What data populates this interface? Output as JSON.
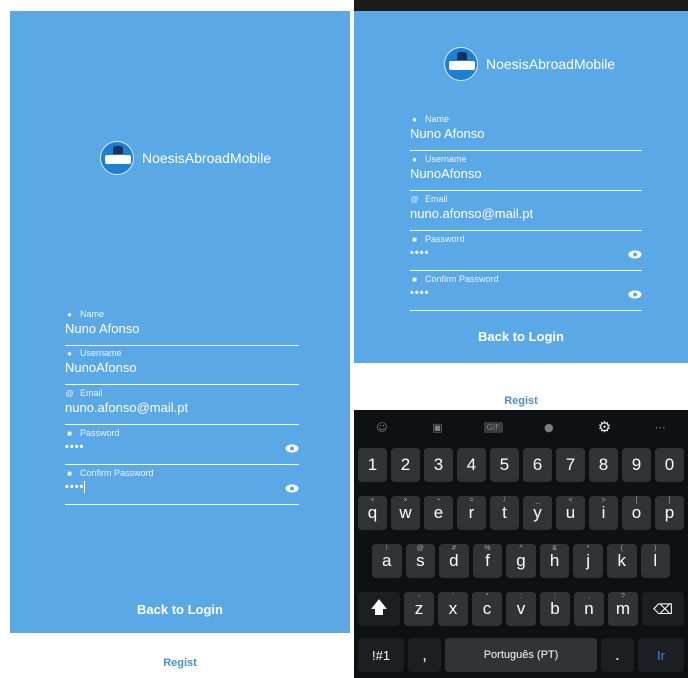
{
  "app": {
    "name": "NoesisAbroadMobile"
  },
  "form": {
    "fields": [
      {
        "label": "Name",
        "icon": "person-icon",
        "value": "Nuno Afonso"
      },
      {
        "label": "Username",
        "icon": "person-icon",
        "value": "NunoAfonso"
      },
      {
        "label": "Email",
        "icon": "at-icon",
        "value": "nuno.afonso@mail.pt"
      },
      {
        "label": "Password",
        "icon": "lock-icon",
        "value": "••••"
      },
      {
        "label": "Confirm Password",
        "icon": "lock-icon",
        "value": "••••"
      }
    ],
    "back_to_login": "Back to Login",
    "regist": "Regist"
  },
  "keyboard": {
    "toolbar": [
      "emoji-icon",
      "sticker-icon",
      "gif-icon",
      "microphone-icon",
      "settings-icon",
      "more-icon"
    ],
    "gif_label": "GIF",
    "numbers": [
      "1",
      "2",
      "3",
      "4",
      "5",
      "6",
      "7",
      "8",
      "9",
      "0"
    ],
    "row1": [
      [
        "q",
        "+"
      ],
      [
        "w",
        "×"
      ],
      [
        "e",
        "÷"
      ],
      [
        "r",
        "="
      ],
      [
        "t",
        "/"
      ],
      [
        "y",
        "_"
      ],
      [
        "u",
        "<"
      ],
      [
        "i",
        ">"
      ],
      [
        "o",
        "["
      ],
      [
        "p",
        "]"
      ]
    ],
    "row2": [
      [
        "a",
        "!"
      ],
      [
        "s",
        "@"
      ],
      [
        "d",
        "#"
      ],
      [
        "f",
        "%"
      ],
      [
        "g",
        "^"
      ],
      [
        "h",
        "&"
      ],
      [
        "j",
        "*"
      ],
      [
        "k",
        "("
      ],
      [
        "l",
        ")"
      ]
    ],
    "row3": [
      [
        "z",
        "-"
      ],
      [
        "x",
        "'"
      ],
      [
        "c",
        "\""
      ],
      [
        "v",
        ":"
      ],
      [
        "b",
        ";"
      ],
      [
        "n",
        ","
      ],
      [
        "m",
        "?"
      ]
    ],
    "symbols_key": "!#1",
    "comma_key": ",",
    "space_label": "Português (PT)",
    "period_key": ".",
    "enter_label": "Ir"
  }
}
